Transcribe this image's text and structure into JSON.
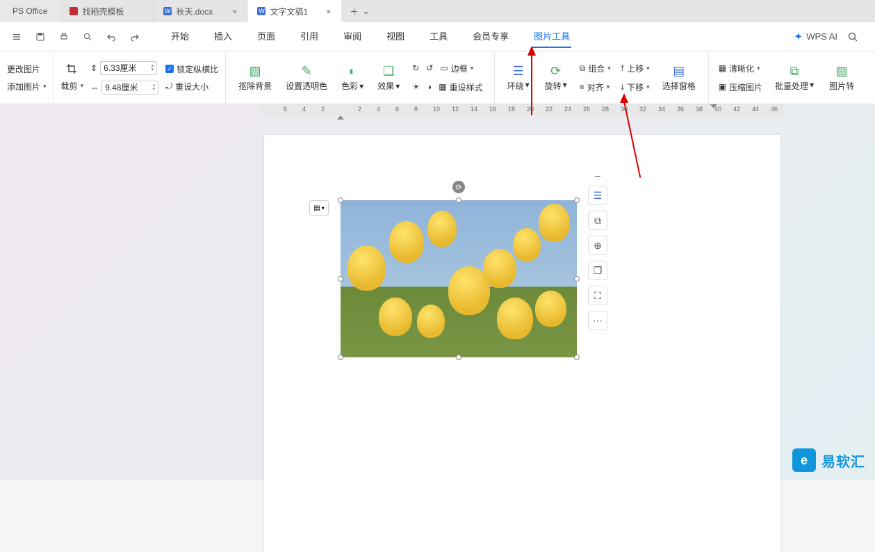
{
  "app": {
    "name": "PS Office"
  },
  "tabs": [
    {
      "label": "找稻壳模板",
      "kind": "template",
      "active": false
    },
    {
      "label": "秋天.docx",
      "kind": "doc",
      "active": false,
      "dirty": "●"
    },
    {
      "label": "文字文稿1",
      "kind": "doc",
      "active": true,
      "dirty": "●"
    }
  ],
  "newtab": {
    "plus": "＋",
    "chev": "⌄"
  },
  "menus": {
    "items": [
      "开始",
      "插入",
      "页面",
      "引用",
      "审阅",
      "视图",
      "工具",
      "会员专享",
      "图片工具"
    ],
    "selected": "图片工具"
  },
  "menubar_right": {
    "wps_ai": "WPS AI"
  },
  "ribbon": {
    "change": "更改图片",
    "addpic": "添加图片",
    "crop": "裁剪",
    "height": "6.33厘米",
    "width": "9.48厘米",
    "lock": "锁定纵横比",
    "reset_size": "重设大小",
    "remove_bg": "抠除背景",
    "set_alpha": "设置透明色",
    "color": "色彩",
    "effect": "效果",
    "border": "边框",
    "reset_style": "重设样式",
    "wrap": "环绕",
    "rotate": "旋转",
    "group": "组合",
    "align": "对齐",
    "moveup": "上移",
    "movedown": "下移",
    "select_pane": "选择窗格",
    "sharpen": "清晰化",
    "compress": "压缩图片",
    "batch": "批量处理",
    "convert": "图片转"
  },
  "ruler": {
    "ticks": [
      "6",
      "4",
      "2",
      "2",
      "4",
      "6",
      "8",
      "10",
      "12",
      "14",
      "16",
      "18",
      "20",
      "22",
      "24",
      "26",
      "28",
      "30",
      "32",
      "34",
      "36",
      "38",
      "40",
      "42",
      "44",
      "46"
    ]
  },
  "floatbar": {
    "items": [
      "–",
      "wrap",
      "crop",
      "zoom",
      "copy",
      "ocr",
      "more"
    ]
  },
  "watermark": {
    "text": "易软汇"
  }
}
